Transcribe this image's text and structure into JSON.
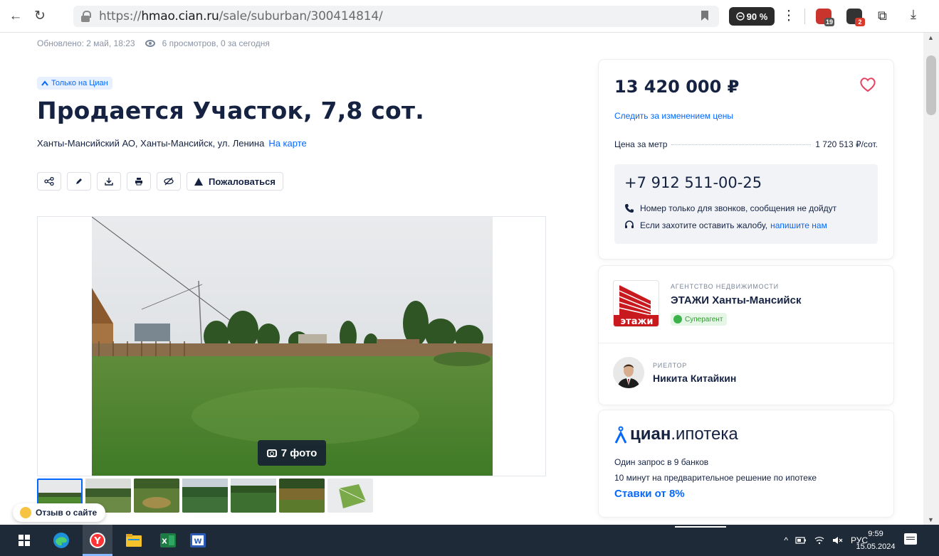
{
  "browser": {
    "url_prefix": "https://",
    "url_host": "hmao.cian.ru",
    "url_path": "/sale/suburban/300414814/",
    "zoom": "90 %",
    "ext1_badge": "19",
    "ext2_badge": "2"
  },
  "listing": {
    "updated": "Обновлено: 2 май, 18:23",
    "views": "6 просмотров, 0 за сегодня",
    "badge": "Только на Циан",
    "title": "Продается Участок, 7,8 сот.",
    "address": "Ханты-Мансийский АО, Ханты-Мансийск, ул. Ленина",
    "map_link": "На карте",
    "complain_label": "Пожаловаться",
    "photos_label": "7 фото"
  },
  "price_card": {
    "price": "13 420 000 ₽",
    "follow": "Следить за изменением цены",
    "per_meter_label": "Цена за метр",
    "per_meter_value": "1 720 513 ₽/сот.",
    "phone": "+7 912 511-00-25",
    "note_calls": "Номер только для звонков, сообщения не дойдут",
    "note_complaint": "Если захотите оставить жалобу,",
    "note_complaint_link": "напишите нам"
  },
  "agency": {
    "label": "АГЕНТСТВО НЕДВИЖИМОСТИ",
    "name": "ЭТАЖИ Ханты-Мансийск",
    "badge": "Суперагент",
    "logo_text": "этажи",
    "realtor_label": "РИЕЛТОР",
    "realtor_name": "Никита Китайкин"
  },
  "mortgage": {
    "logo_main": "циан",
    "logo_sub": ".ипотека",
    "line1": "Один запрос в 9 банков",
    "line2": "10 минут на предварительное решение по ипотеке",
    "rate": "Ставки от 8%"
  },
  "feedback": {
    "label": "Отзыв о сайте"
  },
  "taskbar": {
    "lang": "РУС",
    "time": "9:59",
    "date": "15.05.2024"
  },
  "colors": {
    "accent": "#0468ff",
    "text": "#152242",
    "heart": "#e84260"
  }
}
